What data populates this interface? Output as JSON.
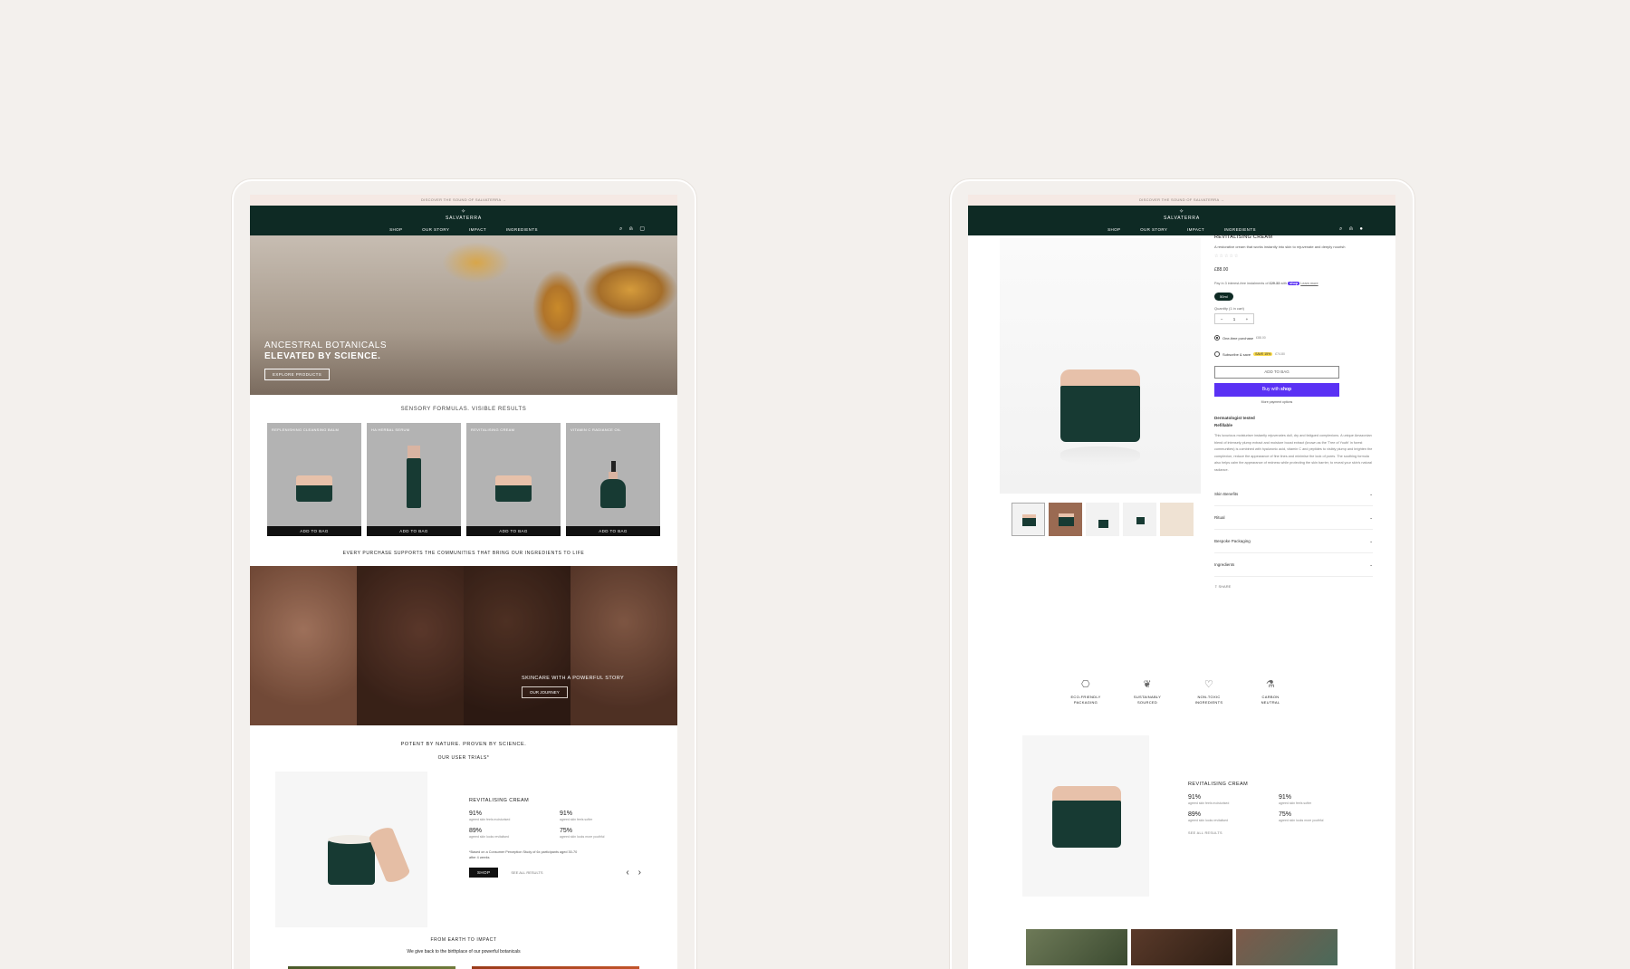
{
  "colors": {
    "brand_green": "#0e2a24",
    "shop_purple": "#5a31f4",
    "background": "#f3f0ed"
  },
  "left": {
    "announcement": "DISCOVER THE SOUND OF SALVATERRA →",
    "logo": "SALVATERRA",
    "nav": [
      "SHOP",
      "OUR STORY",
      "IMPACT",
      "INGREDIENTS"
    ],
    "nav_icons": [
      "search-icon",
      "account-icon",
      "bag-icon"
    ],
    "hero": {
      "line1": "ANCESTRAL BOTANICALS",
      "line2": "ELEVATED BY SCIENCE.",
      "button": "EXPLORE PRODUCTS"
    },
    "products_title": "SENSORY FORMULAS. VISIBLE RESULTS",
    "products": [
      {
        "name": "REPLENISHING CLEANSING BALM",
        "button": "ADD TO BAG"
      },
      {
        "name": "HA HERBAL SERUM",
        "button": "ADD TO BAG"
      },
      {
        "name": "REVITALISING CREAM",
        "button": "ADD TO BAG"
      },
      {
        "name": "VITAMIN C RADIANCE OIL",
        "button": "ADD TO BAG"
      }
    ],
    "community": "EVERY PURCHASE SUPPORTS THE COMMUNITIES THAT BRING OUR INGREDIENTS TO LIFE",
    "story": {
      "title": "SKINCARE WITH A POWERFUL STORY",
      "button": "OUR JOURNEY"
    },
    "proven": {
      "line1": "POTENT BY NATURE. PROVEN BY SCIENCE.",
      "line2": "OUR USER TRIALS*"
    },
    "trial": {
      "title": "REVITALISING CREAM",
      "stats": [
        {
          "pct": "91%",
          "label": "agreed skin feels moisturised"
        },
        {
          "pct": "91%",
          "label": "agreed skin feels softer"
        },
        {
          "pct": "89%",
          "label": "agreed skin looks revitalised"
        },
        {
          "pct": "75%",
          "label": "agreed skin looks more youthful"
        }
      ],
      "note": "*Based on a Consumer Perception Study of 6x participants aged 30-70 after 4 weeks",
      "shop": "SHOP",
      "see_all": "SEE ALL RESULTS"
    },
    "earth": {
      "title": "FROM EARTH TO IMPACT",
      "subtitle": "We give back to the birthplace of our powerful botanicals"
    }
  },
  "right": {
    "announcement": "DISCOVER THE SOUND OF SALVATERRA →",
    "logo": "SALVATERRA",
    "nav": [
      "SHOP",
      "OUR STORY",
      "IMPACT",
      "INGREDIENTS"
    ],
    "product": {
      "title": "REVITALISING CREAM",
      "description": "A restorative cream that works instantly into skin to rejuvenate and deeply nourish",
      "stars": "☆☆☆☆☆",
      "price": "£88.00",
      "pay_prefix": "Pay in 3 interest-free instalments of",
      "pay_amount": "£29.33",
      "pay_with": "with",
      "shop_badge": "shop",
      "learn_more": "Learn more",
      "size": "50ml",
      "qty_label": "Quantity (1 in cart)",
      "qty_minus": "−",
      "qty_value": "1",
      "qty_plus": "+",
      "one_time": "One-time purchase",
      "one_time_price": "£88.00",
      "subscribe": "Subscribe & save",
      "save_badge": "SAVE 15%",
      "subscribe_price": "£74.80",
      "add_to_bag": "ADD TO BAG",
      "buy_with": "Buy with",
      "buy_shop": "shop",
      "more_payment": "More payment options",
      "badge1": "Dermatologist tested",
      "badge2": "Refillable",
      "long_description": "This luxurious moisturiser instantly rejuvenates dull, dry and fatigued complexions. A unique Amazonian blend of intensely plump extract and moisture boost extract (known as the 'Tree of Youth' in forest communities) is combined with hyaluronic acid, vitamin C and peptides to visibly plump and brighten the complexion, reduce the appearance of fine lines and minimise the look of pores. The soothing formula also helps calm the appearance of redness while protecting the skin barrier, to reveal your skin's natural radiance.",
      "accordions": [
        "Skin Benefits",
        "Ritual",
        "Bespoke Packaging",
        "Ingredients"
      ],
      "share": "SHARE"
    },
    "features": [
      {
        "icon": "box-icon",
        "line1": "ECO-FRIENDLY",
        "line2": "PACKAGING"
      },
      {
        "icon": "leaf-icon",
        "line1": "SUSTAINABLY",
        "line2": "SOURCED"
      },
      {
        "icon": "hands-icon",
        "line1": "NON-TOXIC",
        "line2": "INGREDIENTS"
      },
      {
        "icon": "flask-icon",
        "line1": "CARBON",
        "line2": "NEUTRAL"
      }
    ],
    "trial": {
      "title": "REVITALISING CREAM",
      "stats": [
        {
          "pct": "91%",
          "label": "agreed skin feels moisturised"
        },
        {
          "pct": "91%",
          "label": "agreed skin feels softer"
        },
        {
          "pct": "89%",
          "label": "agreed skin looks revitalised"
        },
        {
          "pct": "75%",
          "label": "agreed skin looks more youthful"
        }
      ],
      "see_all": "SEE ALL RESULTS"
    }
  }
}
